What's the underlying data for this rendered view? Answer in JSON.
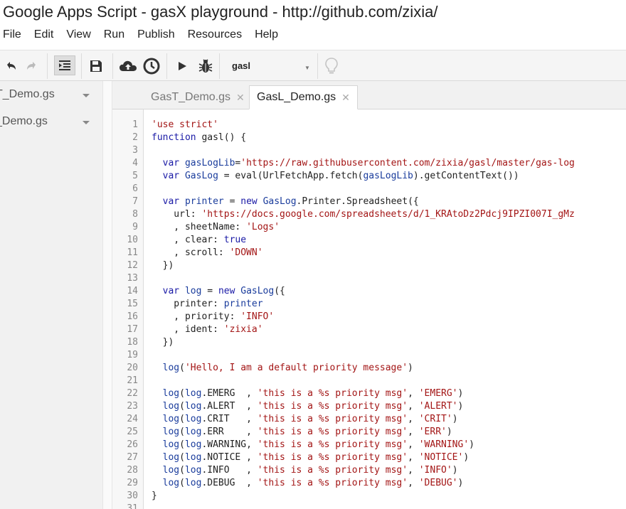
{
  "window": {
    "title": "Google Apps Script - gasX playground - http://github.com/zixia/"
  },
  "menu": [
    {
      "label": "File"
    },
    {
      "label": "Edit"
    },
    {
      "label": "View"
    },
    {
      "label": "Run"
    },
    {
      "label": "Publish"
    },
    {
      "label": "Resources"
    },
    {
      "label": "Help"
    }
  ],
  "toolbar": {
    "function_select": "gasl",
    "icons": [
      "undo-icon",
      "redo-icon",
      "indent-icon",
      "save-icon",
      "cloud-upload-icon",
      "clock-icon",
      "run-icon",
      "debug-icon",
      "lightbulb-icon"
    ]
  },
  "sidebar": {
    "files": [
      {
        "name": "T_Demo.gs"
      },
      {
        "name": "_Demo.gs"
      }
    ]
  },
  "tabs": [
    {
      "label": "GasT_Demo.gs",
      "active": false
    },
    {
      "label": "GasL_Demo.gs",
      "active": true
    }
  ],
  "editor": {
    "line_numbers": [
      "1",
      "2",
      "3",
      "4",
      "5",
      "6",
      "7",
      "8",
      "9",
      "10",
      "11",
      "12",
      "13",
      "14",
      "15",
      "16",
      "17",
      "18",
      "19",
      "20",
      "21",
      "22",
      "23",
      "24",
      "25",
      "26",
      "27",
      "28",
      "29",
      "30",
      "31"
    ],
    "lines": [
      [
        {
          "t": "'use strict'",
          "c": "st"
        }
      ],
      [
        {
          "t": "function",
          "c": "kw"
        },
        {
          "t": " gasl() {"
        }
      ],
      [],
      [
        {
          "t": "  "
        },
        {
          "t": "var",
          "c": "kw"
        },
        {
          "t": " "
        },
        {
          "t": "gasLogLib",
          "c": "vr"
        },
        {
          "t": "="
        },
        {
          "t": "'https://raw.githubusercontent.com/zixia/gasl/master/gas-log",
          "c": "st"
        }
      ],
      [
        {
          "t": "  "
        },
        {
          "t": "var",
          "c": "kw"
        },
        {
          "t": " "
        },
        {
          "t": "GasLog",
          "c": "vr"
        },
        {
          "t": " = eval(UrlFetchApp.fetch("
        },
        {
          "t": "gasLogLib",
          "c": "vr"
        },
        {
          "t": ").getContentText())"
        }
      ],
      [],
      [
        {
          "t": "  "
        },
        {
          "t": "var",
          "c": "kw"
        },
        {
          "t": " "
        },
        {
          "t": "printer",
          "c": "vr"
        },
        {
          "t": " = "
        },
        {
          "t": "new",
          "c": "kw"
        },
        {
          "t": " "
        },
        {
          "t": "GasLog",
          "c": "vr"
        },
        {
          "t": ".Printer.Spreadsheet({"
        }
      ],
      [
        {
          "t": "    url: "
        },
        {
          "t": "'https://docs.google.com/spreadsheets/d/1_KRAtoDz2Pdcj9IPZI007I_gMz",
          "c": "st"
        }
      ],
      [
        {
          "t": "    , sheetName: "
        },
        {
          "t": "'Logs'",
          "c": "st"
        }
      ],
      [
        {
          "t": "    , clear: "
        },
        {
          "t": "true",
          "c": "kw"
        }
      ],
      [
        {
          "t": "    , scroll: "
        },
        {
          "t": "'DOWN'",
          "c": "st"
        }
      ],
      [
        {
          "t": "  })"
        }
      ],
      [],
      [
        {
          "t": "  "
        },
        {
          "t": "var",
          "c": "kw"
        },
        {
          "t": " "
        },
        {
          "t": "log",
          "c": "vr"
        },
        {
          "t": " = "
        },
        {
          "t": "new",
          "c": "kw"
        },
        {
          "t": " "
        },
        {
          "t": "GasLog",
          "c": "vr"
        },
        {
          "t": "({"
        }
      ],
      [
        {
          "t": "    printer: "
        },
        {
          "t": "printer",
          "c": "vr"
        }
      ],
      [
        {
          "t": "    , priority: "
        },
        {
          "t": "'INFO'",
          "c": "st"
        }
      ],
      [
        {
          "t": "    , ident: "
        },
        {
          "t": "'zixia'",
          "c": "st"
        }
      ],
      [
        {
          "t": "  })"
        }
      ],
      [],
      [
        {
          "t": "  "
        },
        {
          "t": "log",
          "c": "vr"
        },
        {
          "t": "("
        },
        {
          "t": "'Hello, I am a default priority message'",
          "c": "st"
        },
        {
          "t": ")"
        }
      ],
      [],
      [
        {
          "t": "  "
        },
        {
          "t": "log",
          "c": "vr"
        },
        {
          "t": "("
        },
        {
          "t": "log",
          "c": "vr"
        },
        {
          "t": ".EMERG  , "
        },
        {
          "t": "'this is a %s priority msg'",
          "c": "st"
        },
        {
          "t": ", "
        },
        {
          "t": "'EMERG'",
          "c": "st"
        },
        {
          "t": ")"
        }
      ],
      [
        {
          "t": "  "
        },
        {
          "t": "log",
          "c": "vr"
        },
        {
          "t": "("
        },
        {
          "t": "log",
          "c": "vr"
        },
        {
          "t": ".ALERT  , "
        },
        {
          "t": "'this is a %s priority msg'",
          "c": "st"
        },
        {
          "t": ", "
        },
        {
          "t": "'ALERT'",
          "c": "st"
        },
        {
          "t": ")"
        }
      ],
      [
        {
          "t": "  "
        },
        {
          "t": "log",
          "c": "vr"
        },
        {
          "t": "("
        },
        {
          "t": "log",
          "c": "vr"
        },
        {
          "t": ".CRIT   , "
        },
        {
          "t": "'this is a %s priority msg'",
          "c": "st"
        },
        {
          "t": ", "
        },
        {
          "t": "'CRIT'",
          "c": "st"
        },
        {
          "t": ")"
        }
      ],
      [
        {
          "t": "  "
        },
        {
          "t": "log",
          "c": "vr"
        },
        {
          "t": "("
        },
        {
          "t": "log",
          "c": "vr"
        },
        {
          "t": ".ERR    , "
        },
        {
          "t": "'this is a %s priority msg'",
          "c": "st"
        },
        {
          "t": ", "
        },
        {
          "t": "'ERR'",
          "c": "st"
        },
        {
          "t": ")"
        }
      ],
      [
        {
          "t": "  "
        },
        {
          "t": "log",
          "c": "vr"
        },
        {
          "t": "("
        },
        {
          "t": "log",
          "c": "vr"
        },
        {
          "t": ".WARNING, "
        },
        {
          "t": "'this is a %s priority msg'",
          "c": "st"
        },
        {
          "t": ", "
        },
        {
          "t": "'WARNING'",
          "c": "st"
        },
        {
          "t": ")"
        }
      ],
      [
        {
          "t": "  "
        },
        {
          "t": "log",
          "c": "vr"
        },
        {
          "t": "("
        },
        {
          "t": "log",
          "c": "vr"
        },
        {
          "t": ".NOTICE , "
        },
        {
          "t": "'this is a %s priority msg'",
          "c": "st"
        },
        {
          "t": ", "
        },
        {
          "t": "'NOTICE'",
          "c": "st"
        },
        {
          "t": ")"
        }
      ],
      [
        {
          "t": "  "
        },
        {
          "t": "log",
          "c": "vr"
        },
        {
          "t": "("
        },
        {
          "t": "log",
          "c": "vr"
        },
        {
          "t": ".INFO   , "
        },
        {
          "t": "'this is a %s priority msg'",
          "c": "st"
        },
        {
          "t": ", "
        },
        {
          "t": "'INFO'",
          "c": "st"
        },
        {
          "t": ")"
        }
      ],
      [
        {
          "t": "  "
        },
        {
          "t": "log",
          "c": "vr"
        },
        {
          "t": "("
        },
        {
          "t": "log",
          "c": "vr"
        },
        {
          "t": ".DEBUG  , "
        },
        {
          "t": "'this is a %s priority msg'",
          "c": "st"
        },
        {
          "t": ", "
        },
        {
          "t": "'DEBUG'",
          "c": "st"
        },
        {
          "t": ")"
        }
      ],
      [
        {
          "t": "}"
        }
      ],
      []
    ]
  }
}
